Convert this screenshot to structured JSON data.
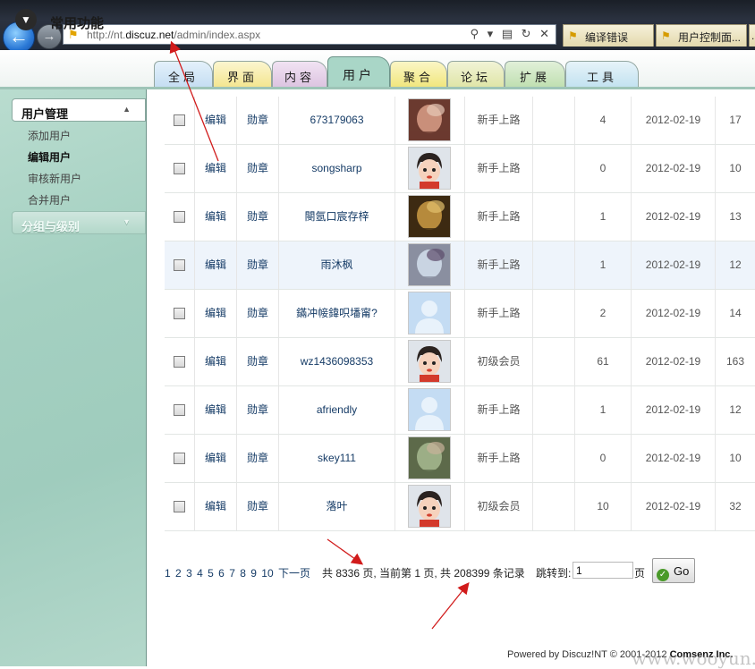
{
  "browser": {
    "url_prefix": "http://nt.",
    "url_domain": "discuz.net",
    "url_path": "/admin/index.aspx",
    "address_controls": "⚲ ▾ ▤ ↻ ✕",
    "tabs": [
      {
        "label": "编译错误"
      },
      {
        "label": "用户控制面..."
      },
      {
        "label": "..."
      }
    ]
  },
  "header": {
    "quick_label": "常用功能",
    "tabs": [
      {
        "label": "全局"
      },
      {
        "label": "界面"
      },
      {
        "label": "内容"
      },
      {
        "label": "用户"
      },
      {
        "label": "聚合"
      },
      {
        "label": "论坛"
      },
      {
        "label": "扩展"
      },
      {
        "label": "工具"
      }
    ],
    "active_tab": "用户"
  },
  "sidebar": {
    "sections": [
      {
        "title": "用户管理",
        "items": [
          {
            "label": "添加用户"
          },
          {
            "label": "编辑用户"
          },
          {
            "label": "审核新用户"
          },
          {
            "label": "合并用户"
          }
        ]
      },
      {
        "title": "分组与级别"
      }
    ],
    "current_item": "编辑用户"
  },
  "table": {
    "rows": [
      {
        "edit": "编辑",
        "medal": "勋章",
        "username": "673179063",
        "avatar": "photo",
        "group": "新手上路",
        "posts": "4",
        "date": "2012-02-19",
        "last": "17"
      },
      {
        "edit": "编辑",
        "medal": "勋章",
        "username": "songsharp",
        "avatar": "cartoon",
        "group": "新手上路",
        "posts": "0",
        "date": "2012-02-19",
        "last": "10"
      },
      {
        "edit": "编辑",
        "medal": "勋章",
        "username": "閿氬口宸存梓",
        "avatar": "photo",
        "group": "新手上路",
        "posts": "1",
        "date": "2012-02-19",
        "last": "13"
      },
      {
        "edit": "编辑",
        "medal": "勋章",
        "username": "雨沐枫",
        "avatar": "photo",
        "group": "新手上路",
        "posts": "1",
        "date": "2012-02-19",
        "last": "12"
      },
      {
        "edit": "编辑",
        "medal": "勋章",
        "username": "鏋冲帹鍏呮墦甯?",
        "avatar": "default",
        "group": "新手上路",
        "posts": "2",
        "date": "2012-02-19",
        "last": "14"
      },
      {
        "edit": "编辑",
        "medal": "勋章",
        "username": "wz1436098353",
        "avatar": "cartoon",
        "group": "初级会员",
        "posts": "61",
        "date": "2012-02-19",
        "last": "163"
      },
      {
        "edit": "编辑",
        "medal": "勋章",
        "username": "afriendly",
        "avatar": "default",
        "group": "新手上路",
        "posts": "1",
        "date": "2012-02-19",
        "last": "12"
      },
      {
        "edit": "编辑",
        "medal": "勋章",
        "username": "skey111",
        "avatar": "photo",
        "group": "新手上路",
        "posts": "0",
        "date": "2012-02-19",
        "last": "10"
      },
      {
        "edit": "编辑",
        "medal": "勋章",
        "username": "落叶",
        "avatar": "cartoon",
        "group": "初级会员",
        "posts": "10",
        "date": "2012-02-19",
        "last": "32"
      }
    ]
  },
  "pager": {
    "pages": [
      "1",
      "2",
      "3",
      "4",
      "5",
      "6",
      "7",
      "8",
      "9",
      "10"
    ],
    "next_label": "下一页",
    "summary": "共 8336 页, 当前第 1 页, 共 208399 条记录",
    "jump_label": "跳转到:",
    "jump_value": "1",
    "jump_unit": "页",
    "go_label": "Go"
  },
  "footer": {
    "powered_prefix": "Powered by ",
    "product": "Discuz!NT",
    "copyright": " © 2001-2012 ",
    "company": "Comsenz Inc."
  },
  "watermark": "www.wooyun.org",
  "colors": {
    "tab_gradient": [
      "#cfe3f5",
      "#f8eda8",
      "#e6cfe9",
      "#a9d6c7",
      "#f5ef9c",
      "#e8ecb8",
      "#cfe7c4",
      "#d6ecf6"
    ],
    "sidebar_bg": "#a4d0c1",
    "annotation_arrow": "#d11b1b"
  }
}
